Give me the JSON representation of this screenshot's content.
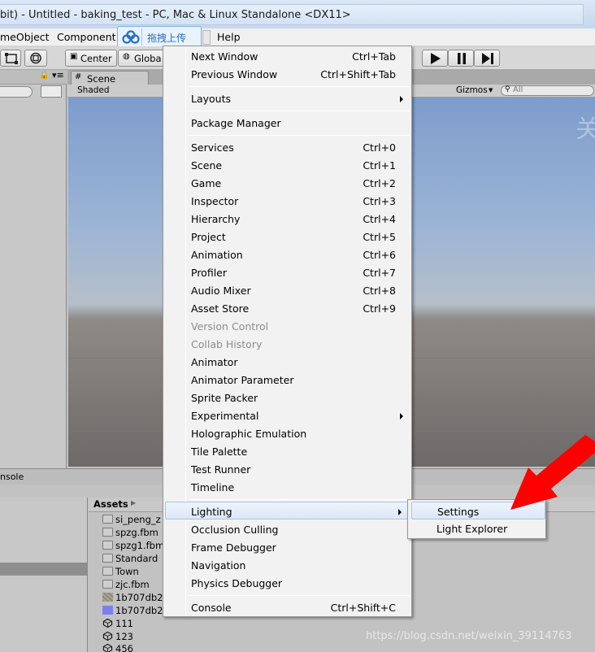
{
  "window": {
    "title": "bit) - Untitled - baking_test - PC, Mac & Linux Standalone <DX11>"
  },
  "menubar": {
    "items": [
      "meObject",
      "Component",
      "Help"
    ],
    "upload_button": "拖拽上传"
  },
  "toolbar": {
    "center": "Center",
    "global": "Globa"
  },
  "scene": {
    "tab": "Scene",
    "shaded": "Shaded",
    "gizmos": "Gizmos",
    "search_placeholder": "All",
    "overlay_char": "关"
  },
  "console_strip": "nsole",
  "project": {
    "assets_label": "Assets",
    "assets": [
      {
        "name": "si_peng_z",
        "icon": "folder-icon"
      },
      {
        "name": "spzg.fbm",
        "icon": "folder-icon"
      },
      {
        "name": "spzg1.fbm",
        "icon": "folder-icon"
      },
      {
        "name": "Standard",
        "icon": "folder-icon"
      },
      {
        "name": "Town",
        "icon": "folder-icon"
      },
      {
        "name": "zjc.fbm",
        "icon": "folder-icon"
      },
      {
        "name": "1b707db2",
        "icon": "texture-icon"
      },
      {
        "name": "1b707db2",
        "icon": "material-icon"
      },
      {
        "name": "111",
        "icon": "unity-scene-icon"
      },
      {
        "name": "123",
        "icon": "unity-scene-icon"
      },
      {
        "name": "456",
        "icon": "unity-scene-icon"
      }
    ]
  },
  "dropdown": {
    "items": [
      {
        "label": "Next Window",
        "shortcut": "Ctrl+Tab"
      },
      {
        "label": "Previous Window",
        "shortcut": "Ctrl+Shift+Tab"
      },
      {
        "label": "Layouts",
        "shortcut": ""
      },
      {
        "label": "Package Manager",
        "shortcut": ""
      },
      {
        "label": "Services",
        "shortcut": "Ctrl+0"
      },
      {
        "label": "Scene",
        "shortcut": "Ctrl+1"
      },
      {
        "label": "Game",
        "shortcut": "Ctrl+2"
      },
      {
        "label": "Inspector",
        "shortcut": "Ctrl+3"
      },
      {
        "label": "Hierarchy",
        "shortcut": "Ctrl+4"
      },
      {
        "label": "Project",
        "shortcut": "Ctrl+5"
      },
      {
        "label": "Animation",
        "shortcut": "Ctrl+6"
      },
      {
        "label": "Profiler",
        "shortcut": "Ctrl+7"
      },
      {
        "label": "Audio Mixer",
        "shortcut": "Ctrl+8"
      },
      {
        "label": "Asset Store",
        "shortcut": "Ctrl+9"
      },
      {
        "label": "Version Control",
        "shortcut": ""
      },
      {
        "label": "Collab History",
        "shortcut": ""
      },
      {
        "label": "Animator",
        "shortcut": ""
      },
      {
        "label": "Animator Parameter",
        "shortcut": ""
      },
      {
        "label": "Sprite Packer",
        "shortcut": ""
      },
      {
        "label": "Experimental",
        "shortcut": ""
      },
      {
        "label": "Holographic Emulation",
        "shortcut": ""
      },
      {
        "label": "Tile Palette",
        "shortcut": ""
      },
      {
        "label": "Test Runner",
        "shortcut": ""
      },
      {
        "label": "Timeline",
        "shortcut": ""
      },
      {
        "label": "Lighting",
        "shortcut": ""
      },
      {
        "label": "Occlusion Culling",
        "shortcut": ""
      },
      {
        "label": "Frame Debugger",
        "shortcut": ""
      },
      {
        "label": "Navigation",
        "shortcut": ""
      },
      {
        "label": "Physics Debugger",
        "shortcut": ""
      },
      {
        "label": "Console",
        "shortcut": "Ctrl+Shift+C"
      }
    ]
  },
  "submenu": {
    "items": [
      {
        "label": "Settings"
      },
      {
        "label": "Light Explorer"
      }
    ]
  },
  "watermark": "https://blog.csdn.net/weixin_39114763",
  "colors": {
    "arrow": "#ff0000",
    "highlight": "#dce8f8",
    "sky": "#7e9ccc"
  }
}
